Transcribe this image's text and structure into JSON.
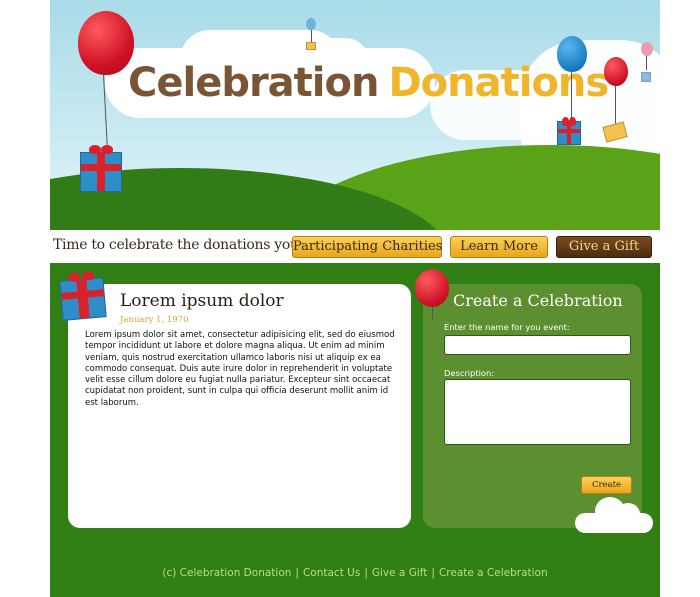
{
  "header": {
    "logo_word1": "Celebration",
    "logo_word2": "Donations"
  },
  "navbar": {
    "tagline": "Time to celebrate the donations you give.",
    "buttons": [
      {
        "label": "Participating Charities"
      },
      {
        "label": "Learn More"
      },
      {
        "label": "Give a Gift"
      }
    ]
  },
  "post": {
    "title": "Lorem ipsum dolor",
    "date": "January 1, 1970",
    "body": "Lorem ipsum dolor sit amet, consectetur adipisicing elit, sed do eiusmod tempor incididunt ut labore et dolore magna aliqua. Ut enim ad minim veniam, quis nostrud exercitation ullamco laboris nisi ut aliquip ex ea commodo consequat. Duis aute irure dolor in reprehenderit in voluptate velit esse cillum dolore eu fugiat nulla pariatur. Excepteur sint occaecat cupidatat non proident, sunt in culpa qui officia deserunt mollit anim id est laborum."
  },
  "create_form": {
    "title": "Create a Celebration",
    "name_label": "Enter the name for you event:",
    "name_value": "",
    "description_label": "Description:",
    "description_value": "",
    "submit_label": "Create"
  },
  "footer": {
    "copyright": "(c) Celebration Donation",
    "links": [
      "Contact Us",
      "Give a Gift",
      "Create a Celebration"
    ],
    "separator": "|"
  },
  "colors": {
    "logo_brown": "#7a5535",
    "logo_gold": "#f0b52a",
    "main_green": "#307f14",
    "form_green": "#5b8f30",
    "button_yellow": "#f0b52a",
    "button_brown": "#5e3616",
    "footer_link": "#b7e07a",
    "date_gold": "#d7a23a"
  },
  "icons": [
    "balloon-icon",
    "gift-icon",
    "envelope-icon",
    "cloud-icon"
  ]
}
